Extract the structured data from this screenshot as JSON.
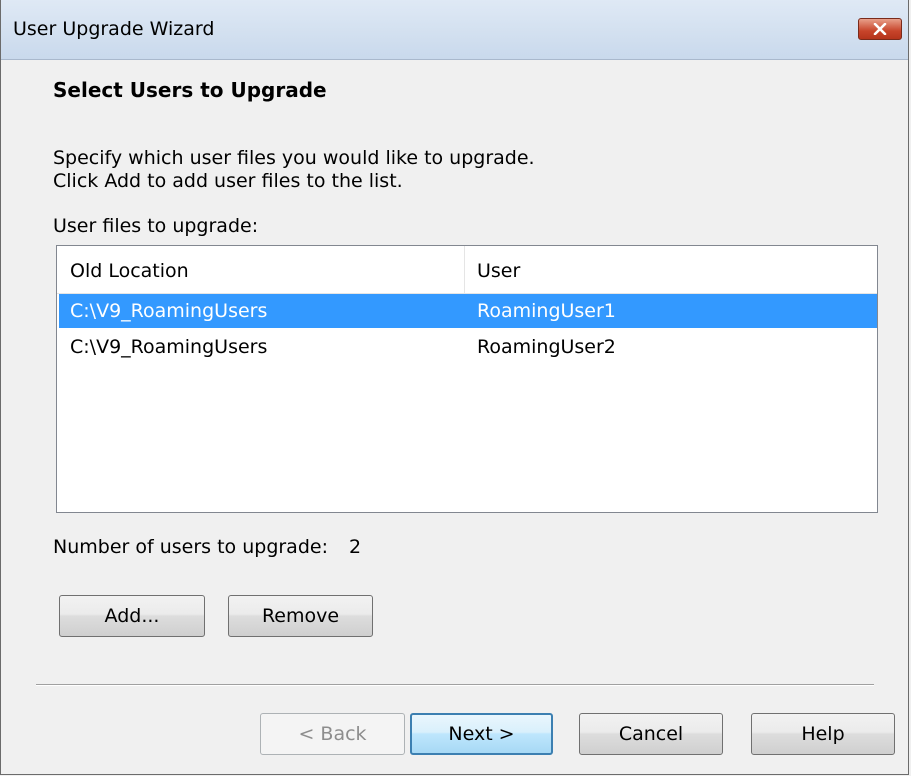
{
  "window": {
    "title": "User Upgrade Wizard"
  },
  "page": {
    "heading": "Select Users to Upgrade",
    "description_line1": "Specify which user files you would like to upgrade.",
    "description_line2": "Click Add to add user files to the list.",
    "list_label": "User files to upgrade:"
  },
  "list": {
    "columns": [
      "Old Location",
      "User"
    ],
    "rows": [
      {
        "location": "C:\\V9_RoamingUsers",
        "user": "RoamingUser1",
        "selected": true
      },
      {
        "location": "C:\\V9_RoamingUsers",
        "user": "RoamingUser2",
        "selected": false
      }
    ]
  },
  "summary": {
    "count_label": "Number of users to upgrade:",
    "count_value": "2"
  },
  "actions": {
    "add_label": "Add...",
    "remove_label": "Remove"
  },
  "footer": {
    "back_label": "< Back",
    "next_label": "Next >",
    "cancel_label": "Cancel",
    "help_label": "Help"
  },
  "colors": {
    "selection": "#3399ff",
    "close_button": "#c7442a"
  },
  "icons": {
    "close": "close-icon"
  }
}
